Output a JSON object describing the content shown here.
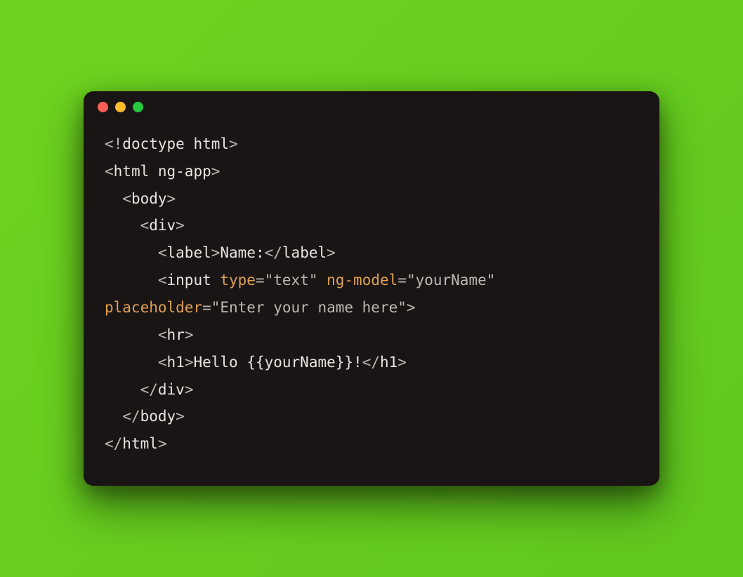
{
  "colors": {
    "background_gradient_from": "#6ed31f",
    "background_gradient_to": "#5fc71e",
    "window_bg": "#1a1515",
    "traffic_red": "#ff5f56",
    "traffic_yellow": "#ffbd2e",
    "traffic_green": "#27c93f",
    "attr_highlight": "#e0a14f",
    "default_text": "#e8e5e0",
    "punctuation": "#bdb7b0"
  },
  "code": {
    "tokens": [
      {
        "cls": "t-punc",
        "text": "<!"
      },
      {
        "cls": "t-tag",
        "text": "doctype html"
      },
      {
        "cls": "t-punc",
        "text": ">"
      },
      {
        "cls": "",
        "text": "\n"
      },
      {
        "cls": "t-punc",
        "text": "<"
      },
      {
        "cls": "t-tag",
        "text": "html ng-app"
      },
      {
        "cls": "t-punc",
        "text": ">"
      },
      {
        "cls": "",
        "text": "\n  "
      },
      {
        "cls": "t-punc",
        "text": "<"
      },
      {
        "cls": "t-tag",
        "text": "body"
      },
      {
        "cls": "t-punc",
        "text": ">"
      },
      {
        "cls": "",
        "text": "\n    "
      },
      {
        "cls": "t-punc",
        "text": "<"
      },
      {
        "cls": "t-tag",
        "text": "div"
      },
      {
        "cls": "t-punc",
        "text": ">"
      },
      {
        "cls": "",
        "text": "\n      "
      },
      {
        "cls": "t-punc",
        "text": "<"
      },
      {
        "cls": "t-tag",
        "text": "label"
      },
      {
        "cls": "t-punc",
        "text": ">"
      },
      {
        "cls": "t-text",
        "text": "Name:"
      },
      {
        "cls": "t-punc",
        "text": "</"
      },
      {
        "cls": "t-tag",
        "text": "label"
      },
      {
        "cls": "t-punc",
        "text": ">"
      },
      {
        "cls": "",
        "text": "\n      "
      },
      {
        "cls": "t-punc",
        "text": "<"
      },
      {
        "cls": "t-tag",
        "text": "input "
      },
      {
        "cls": "t-attr",
        "text": "type"
      },
      {
        "cls": "t-punc",
        "text": "="
      },
      {
        "cls": "t-str",
        "text": "\"text\""
      },
      {
        "cls": "t-tag",
        "text": " "
      },
      {
        "cls": "t-attr",
        "text": "ng-model"
      },
      {
        "cls": "t-punc",
        "text": "="
      },
      {
        "cls": "t-str",
        "text": "\"yourName\""
      },
      {
        "cls": "t-tag",
        "text": " "
      },
      {
        "cls": "t-attr",
        "text": "placeholder"
      },
      {
        "cls": "t-punc",
        "text": "="
      },
      {
        "cls": "t-str",
        "text": "\"Enter your name here\""
      },
      {
        "cls": "t-punc",
        "text": ">"
      },
      {
        "cls": "",
        "text": "\n      "
      },
      {
        "cls": "t-punc",
        "text": "<"
      },
      {
        "cls": "t-tag",
        "text": "hr"
      },
      {
        "cls": "t-punc",
        "text": ">"
      },
      {
        "cls": "",
        "text": "\n      "
      },
      {
        "cls": "t-punc",
        "text": "<"
      },
      {
        "cls": "t-tag",
        "text": "h1"
      },
      {
        "cls": "t-punc",
        "text": ">"
      },
      {
        "cls": "t-text",
        "text": "Hello {{yourName}}!"
      },
      {
        "cls": "t-punc",
        "text": "</"
      },
      {
        "cls": "t-tag",
        "text": "h1"
      },
      {
        "cls": "t-punc",
        "text": ">"
      },
      {
        "cls": "",
        "text": "\n    "
      },
      {
        "cls": "t-punc",
        "text": "</"
      },
      {
        "cls": "t-tag",
        "text": "div"
      },
      {
        "cls": "t-punc",
        "text": ">"
      },
      {
        "cls": "",
        "text": "\n  "
      },
      {
        "cls": "t-punc",
        "text": "</"
      },
      {
        "cls": "t-tag",
        "text": "body"
      },
      {
        "cls": "t-punc",
        "text": ">"
      },
      {
        "cls": "",
        "text": "\n"
      },
      {
        "cls": "t-punc",
        "text": "</"
      },
      {
        "cls": "t-tag",
        "text": "html"
      },
      {
        "cls": "t-punc",
        "text": ">"
      }
    ]
  }
}
